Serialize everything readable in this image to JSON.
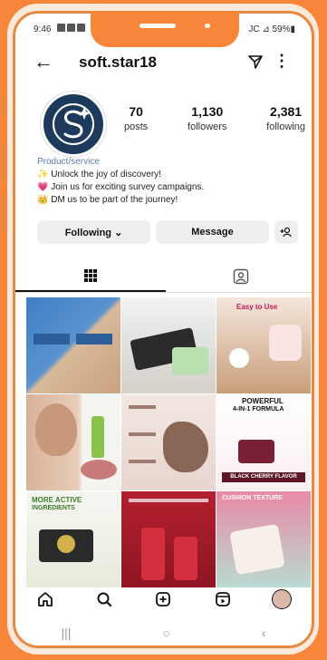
{
  "status": {
    "time": "9:46",
    "right": "JC ⊿ 59%▮"
  },
  "header": {
    "username": "soft.star18"
  },
  "stats": [
    {
      "value": "70",
      "label": "posts"
    },
    {
      "value": "1,130",
      "label": "followers"
    },
    {
      "value": "2,381",
      "label": "following"
    }
  ],
  "bio": {
    "category": "Product/service",
    "lines": [
      "✨ Unlock the joy of discovery!",
      "💗 Join us for exciting survey campaigns.",
      "👑 DM us to be part of the journey!"
    ]
  },
  "actions": {
    "following": "Following ⌄",
    "message": "Message"
  },
  "posts": {
    "p3_title": "Easy to Use",
    "p6_title": "POWERFUL",
    "p6_sub": "4-IN-1 FORMULA",
    "p6_footer": "BLACK CHERRY FLAVOR",
    "p7_title": "MORE ACTIVE",
    "p7_sub": "INGREDIENTS",
    "p9_title": "CUSHION TEXTURE"
  },
  "colors": {
    "frame": "#f7863a",
    "avatar": "#1d3a5c",
    "link": "#5b7fa6"
  }
}
